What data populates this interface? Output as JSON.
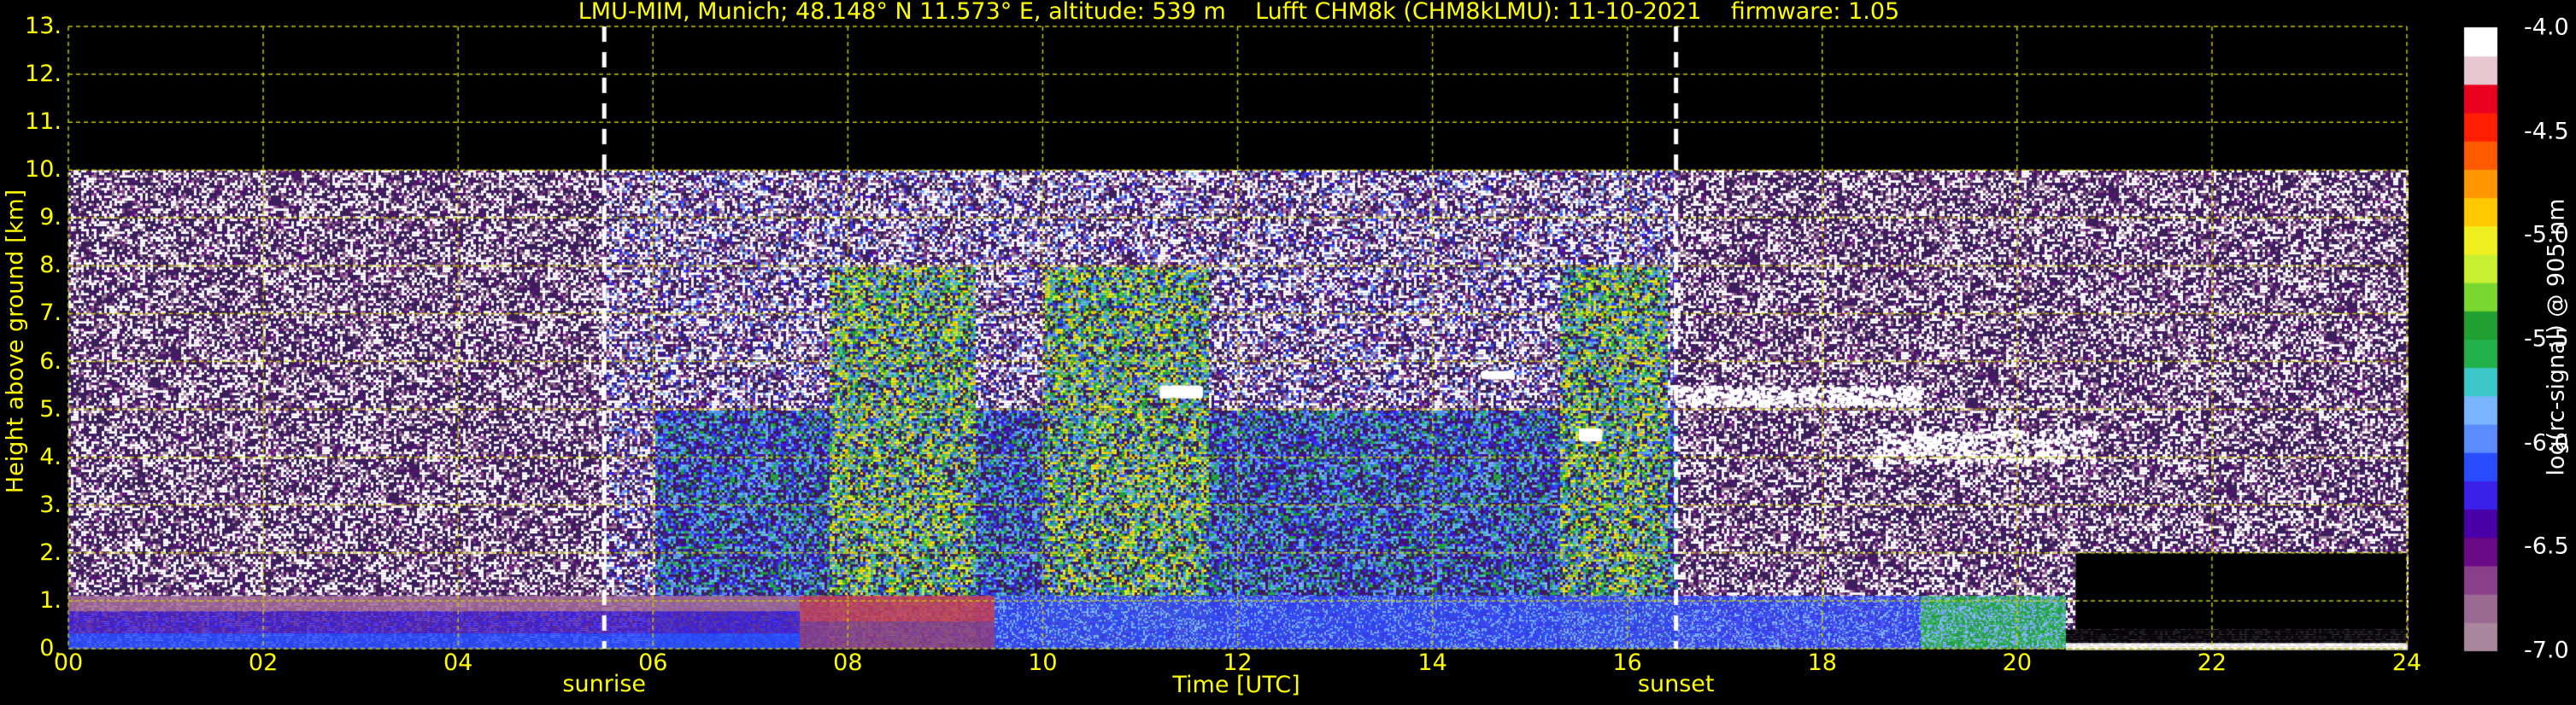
{
  "chart_data": {
    "type": "heatmap",
    "title": "LMU-MIM, Munich; 48.148° N 11.573° E, altitude: 539 m    Lufft CHM8k (CHM8kLMU): 11-10-2021    firmware: 1.05",
    "xlabel": "Time [UTC]",
    "ylabel": "Height above ground [km]",
    "xlim": [
      0,
      24
    ],
    "ylim": [
      0,
      13
    ],
    "xticks": [
      "00",
      "02",
      "04",
      "06",
      "08",
      "10",
      "12",
      "14",
      "16",
      "18",
      "20",
      "22",
      "24"
    ],
    "yticks": [
      "0.",
      "1.",
      "2.",
      "3.",
      "4.",
      "5.",
      "6.",
      "7.",
      "8.",
      "9.",
      "10.",
      "11.",
      "12.",
      "13."
    ],
    "grid": true,
    "data_ceiling_km": 10,
    "markers": [
      {
        "label": "sunrise",
        "x": 5.5
      },
      {
        "label": "sunset",
        "x": 16.5
      }
    ],
    "colorbar": {
      "label": "log(rc-signal) @ 905 nm",
      "range": [
        -7.0,
        -4.0
      ],
      "ticks": [
        "-4.0",
        "-4.5",
        "-5.0",
        "-5.5",
        "-6.0",
        "-6.5",
        "-7.0"
      ],
      "tick_values": [
        -4.0,
        -4.5,
        -5.0,
        -5.5,
        -6.0,
        -6.5,
        -7.0
      ],
      "colors": [
        "#a8869c",
        "#9b6a92",
        "#8a3f8a",
        "#6a0a86",
        "#4a00a8",
        "#3a20e8",
        "#2a4cff",
        "#5a8cff",
        "#7ab4ff",
        "#3cc8c8",
        "#22b04a",
        "#20a030",
        "#7ad830",
        "#c8f030",
        "#f0f020",
        "#ffc800",
        "#ff9600",
        "#ff5a00",
        "#ff1e00",
        "#e8001e",
        "#e8c8d0",
        "#ffffff"
      ]
    },
    "features": [
      {
        "name": "boundary layer",
        "x_range": [
          0,
          24
        ],
        "height_km": [
          0,
          1.1
        ]
      },
      {
        "name": "cloud layer",
        "x_range": [
          16.3,
          20.8
        ],
        "height_km": [
          3.8,
          5.6
        ]
      },
      {
        "name": "isolated clouds",
        "x_range": [
          11.0,
          16.3
        ],
        "height_km": [
          4.3,
          5.8
        ]
      }
    ]
  }
}
